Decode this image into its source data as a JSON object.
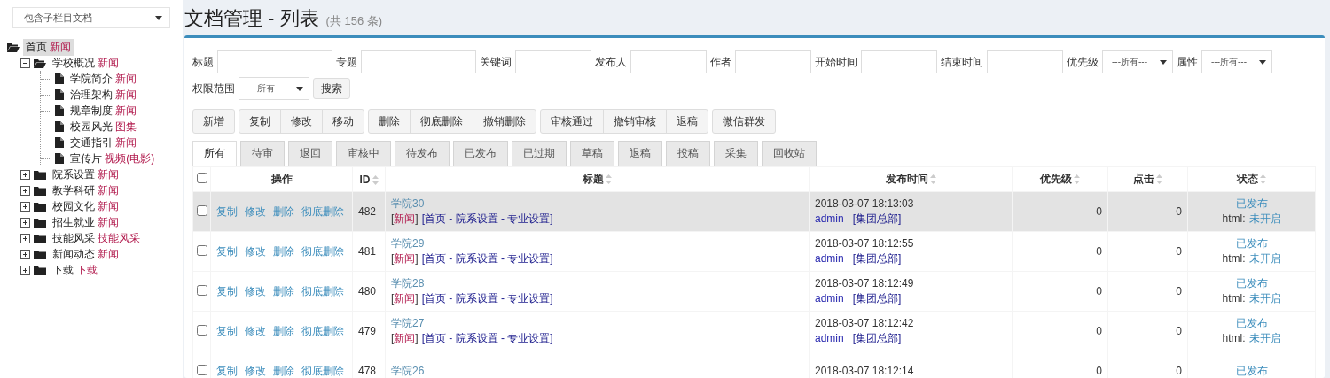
{
  "sidebar": {
    "dropdown": "包含子栏目文档",
    "tree": [
      {
        "label": "首页",
        "tag": "新闻",
        "kind": "folder",
        "expanded": true,
        "selected": true,
        "children": [
          {
            "label": "学校概况",
            "tag": "新闻",
            "kind": "folder",
            "expanded": true,
            "selected": false,
            "children": [
              {
                "label": "学院简介",
                "tag": "新闻",
                "kind": "file",
                "selected": false
              },
              {
                "label": "治理架构",
                "tag": "新闻",
                "kind": "file",
                "selected": false
              },
              {
                "label": "规章制度",
                "tag": "新闻",
                "kind": "file",
                "selected": false
              },
              {
                "label": "校园风光",
                "tag": "图集",
                "kind": "file",
                "selected": false
              },
              {
                "label": "交通指引",
                "tag": "新闻",
                "kind": "file",
                "selected": false
              },
              {
                "label": "宣传片",
                "tag": "视频(电影)",
                "kind": "file",
                "selected": false
              }
            ]
          },
          {
            "label": "院系设置",
            "tag": "新闻",
            "kind": "folder",
            "expanded": false,
            "selected": false
          },
          {
            "label": "教学科研",
            "tag": "新闻",
            "kind": "folder",
            "expanded": false,
            "selected": false
          },
          {
            "label": "校园文化",
            "tag": "新闻",
            "kind": "folder",
            "expanded": false,
            "selected": false
          },
          {
            "label": "招生就业",
            "tag": "新闻",
            "kind": "folder",
            "expanded": false,
            "selected": false
          },
          {
            "label": "技能风采",
            "tag": "技能风采",
            "kind": "folder",
            "expanded": false,
            "selected": false
          },
          {
            "label": "新闻动态",
            "tag": "新闻",
            "kind": "folder",
            "expanded": false,
            "selected": false
          },
          {
            "label": "下载",
            "tag": "下载",
            "kind": "folder",
            "expanded": false,
            "selected": false
          }
        ]
      }
    ]
  },
  "page": {
    "title": "文档管理 - 列表",
    "count": "(共 156 条)"
  },
  "filters": [
    {
      "label": "标题",
      "kind": "widetext"
    },
    {
      "label": "专题",
      "kind": "widetext"
    },
    {
      "label": "关键词",
      "kind": "text"
    },
    {
      "label": "发布人",
      "kind": "text"
    },
    {
      "label": "作者",
      "kind": "text"
    },
    {
      "label": "开始时间",
      "kind": "text"
    },
    {
      "label": "结束时间",
      "kind": "text"
    },
    {
      "label": "优先级",
      "kind": "select",
      "value": "---所有---"
    },
    {
      "label": "属性",
      "kind": "select",
      "value": "---所有---"
    },
    {
      "label": "权限范围",
      "kind": "select",
      "value": "---所有---"
    }
  ],
  "search_button": "搜索",
  "toolbar": [
    [
      "新增"
    ],
    [
      "复制",
      "修改",
      "移动"
    ],
    [
      "删除",
      "彻底删除",
      "撤销删除"
    ],
    [
      "审核通过",
      "撤销审核",
      "退稿"
    ],
    [
      "微信群发"
    ]
  ],
  "tabs": [
    {
      "label": "所有",
      "selected": true
    },
    {
      "label": "待审",
      "selected": false
    },
    {
      "label": "退回",
      "selected": false
    },
    {
      "label": "审核中",
      "selected": false
    },
    {
      "label": "待发布",
      "selected": false
    },
    {
      "label": "已发布",
      "selected": false
    },
    {
      "label": "已过期",
      "selected": false
    },
    {
      "label": "草稿",
      "selected": false
    },
    {
      "label": "退稿",
      "selected": false
    },
    {
      "label": "投稿",
      "selected": false
    },
    {
      "label": "采集",
      "selected": false
    },
    {
      "label": "回收站",
      "selected": false
    }
  ],
  "table": {
    "select_all_checked": false,
    "columns": [
      {
        "label": "操作",
        "sortable": false
      },
      {
        "label": "ID",
        "sortable": true
      },
      {
        "label": "标题",
        "sortable": true
      },
      {
        "label": "发布时间",
        "sortable": true
      },
      {
        "label": "优先级",
        "sortable": true
      },
      {
        "label": "点击",
        "sortable": true
      },
      {
        "label": "状态",
        "sortable": true
      }
    ],
    "rows": [
      {
        "checked": false,
        "highlighted": true,
        "actions": [
          "复制",
          "修改",
          "删除",
          "彻底删除"
        ],
        "id": "482",
        "title": "学院30",
        "tag": "[新闻]",
        "path": "[首页 - 院系设置 - 专业设置]",
        "time": "2018-03-07 18:13:03",
        "author": "admin",
        "dept": "[集团总部]",
        "priority": "0",
        "clicks": "0",
        "status": "已发布",
        "html_label": "html:",
        "html_value": "未开启"
      },
      {
        "checked": false,
        "highlighted": false,
        "actions": [
          "复制",
          "修改",
          "删除",
          "彻底删除"
        ],
        "id": "481",
        "title": "学院29",
        "tag": "[新闻]",
        "path": "[首页 - 院系设置 - 专业设置]",
        "time": "2018-03-07 18:12:55",
        "author": "admin",
        "dept": "[集团总部]",
        "priority": "0",
        "clicks": "0",
        "status": "已发布",
        "html_label": "html:",
        "html_value": "未开启"
      },
      {
        "checked": false,
        "highlighted": false,
        "actions": [
          "复制",
          "修改",
          "删除",
          "彻底删除"
        ],
        "id": "480",
        "title": "学院28",
        "tag": "[新闻]",
        "path": "[首页 - 院系设置 - 专业设置]",
        "time": "2018-03-07 18:12:49",
        "author": "admin",
        "dept": "[集团总部]",
        "priority": "0",
        "clicks": "0",
        "status": "已发布",
        "html_label": "html:",
        "html_value": "未开启"
      },
      {
        "checked": false,
        "highlighted": false,
        "actions": [
          "复制",
          "修改",
          "删除",
          "彻底删除"
        ],
        "id": "479",
        "title": "学院27",
        "tag": "[新闻]",
        "path": "[首页 - 院系设置 - 专业设置]",
        "time": "2018-03-07 18:12:42",
        "author": "admin",
        "dept": "[集团总部]",
        "priority": "0",
        "clicks": "0",
        "status": "已发布",
        "html_label": "html:",
        "html_value": "未开启"
      },
      {
        "checked": false,
        "highlighted": false,
        "actions": [
          "复制",
          "修改",
          "删除",
          "彻底删除"
        ],
        "id": "478",
        "title": "学院26",
        "time": "2018-03-07 18:12:14",
        "priority": "0",
        "clicks": "0",
        "status": "已发布"
      }
    ]
  }
}
